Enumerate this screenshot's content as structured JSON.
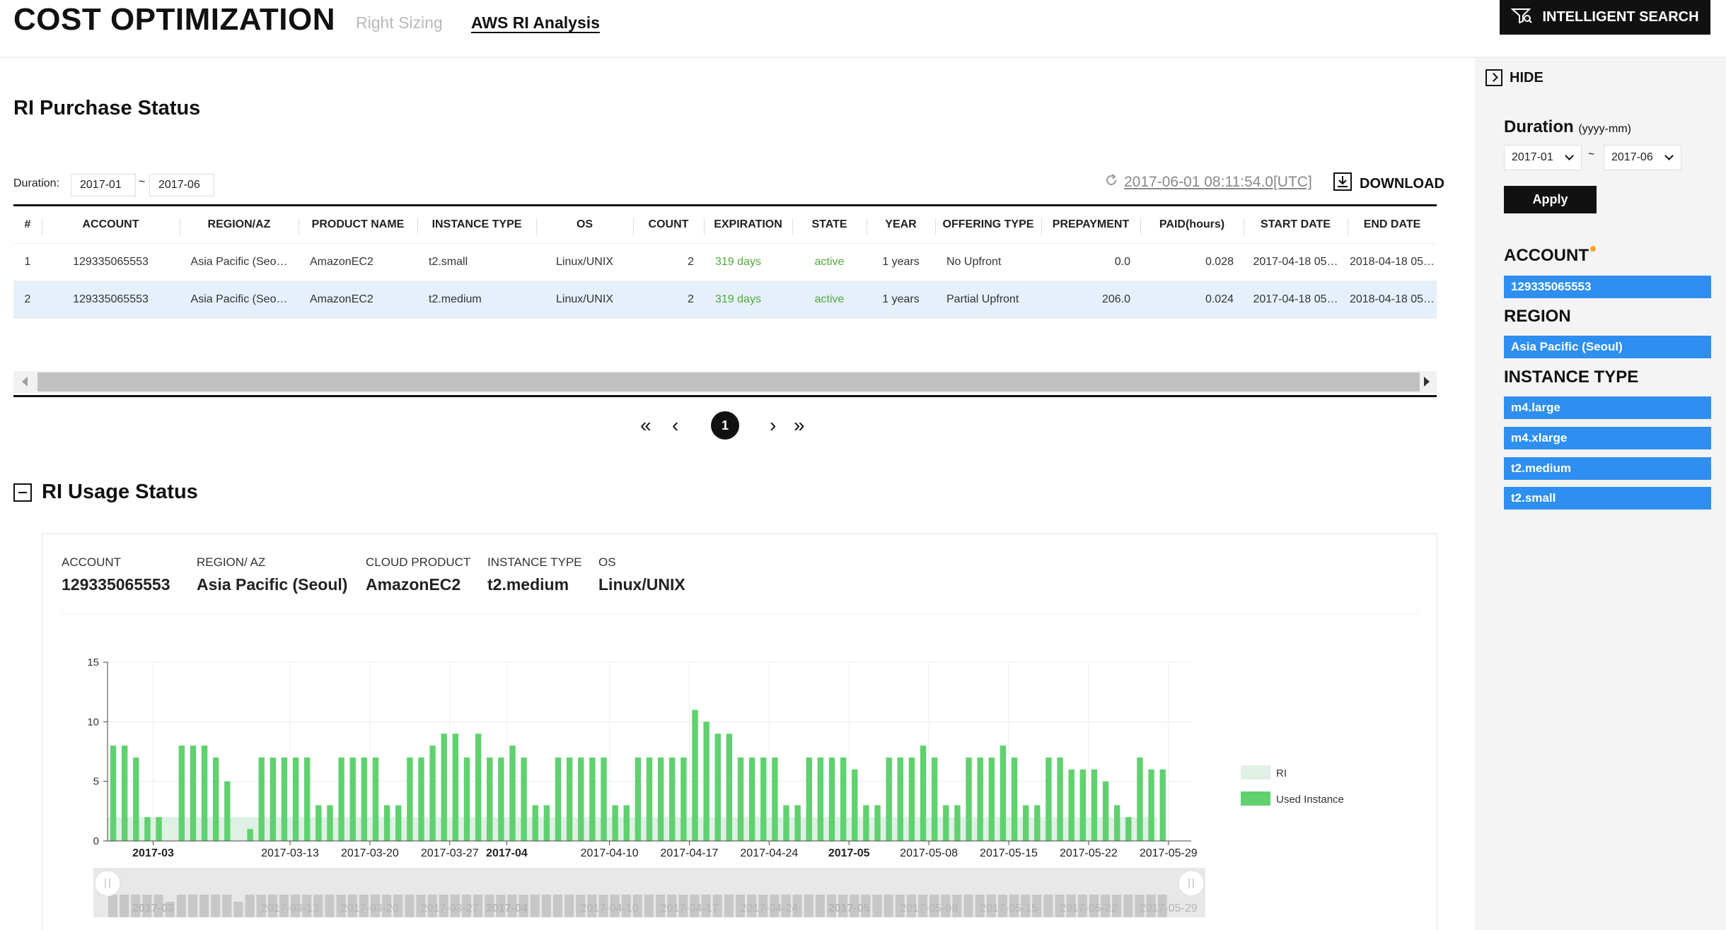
{
  "header": {
    "title": "COST OPTIMIZATION",
    "tabs": [
      {
        "label": "Right Sizing",
        "active": false
      },
      {
        "label": "AWS RI Analysis",
        "active": true
      }
    ],
    "intelligent_search_label": "INTELLIGENT SEARCH"
  },
  "purchase": {
    "title": "RI Purchase Status",
    "duration_label": "Duration:",
    "duration_from": "2017-01",
    "duration_to": "2017-06",
    "tilde": "~",
    "timestamp": "2017-06-01 08:11:54.0[UTC]",
    "download_label": "DOWNLOAD",
    "columns": [
      "#",
      "ACCOUNT",
      "REGION/AZ",
      "PRODUCT NAME",
      "INSTANCE TYPE",
      "OS",
      "COUNT",
      "EXPIRATION",
      "STATE",
      "YEAR",
      "OFFERING TYPE",
      "PREPAYMENT",
      "PAID(hours)",
      "START DATE",
      "END DATE"
    ],
    "rows": [
      {
        "n": "1",
        "account": "129335065553",
        "region": "Asia Pacific (Seo…",
        "product": "AmazonEC2",
        "instance_type": "t2.small",
        "os": "Linux/UNIX",
        "count": "2",
        "expiration": "319 days",
        "state": "active",
        "year": "1 years",
        "offering": "No Upfront",
        "prepayment": "0.0",
        "paid": "0.028",
        "start": "2017-04-18 05…",
        "end": "2018-04-18 05…"
      },
      {
        "n": "2",
        "account": "129335065553",
        "region": "Asia Pacific (Seo…",
        "product": "AmazonEC2",
        "instance_type": "t2.medium",
        "os": "Linux/UNIX",
        "count": "2",
        "expiration": "319 days",
        "state": "active",
        "year": "1 years",
        "offering": "Partial Upfront",
        "prepayment": "206.0",
        "paid": "0.024",
        "start": "2017-04-18 05…",
        "end": "2018-04-18 05…"
      }
    ],
    "pager": {
      "first": "«",
      "prev": "‹",
      "current": "1",
      "next": "›",
      "last": "»"
    }
  },
  "usage": {
    "title": "RI Usage Status",
    "info": [
      {
        "label": "ACCOUNT",
        "value": "129335065553"
      },
      {
        "label": "REGION/ AZ",
        "value": "Asia Pacific (Seoul)"
      },
      {
        "label": "CLOUD PRODUCT",
        "value": "AmazonEC2"
      },
      {
        "label": "INSTANCE TYPE",
        "value": "t2.medium"
      },
      {
        "label": "OS",
        "value": "Linux/UNIX"
      }
    ]
  },
  "sidebar": {
    "hide_label": "HIDE",
    "duration_title": "Duration",
    "duration_hint": "(yyyy-mm)",
    "from": "2017-01",
    "to": "2017-06",
    "tilde": "~",
    "apply_label": "Apply",
    "account_title": "ACCOUNT",
    "account_tags": [
      "129335065553"
    ],
    "region_title": "REGION",
    "region_tags": [
      "Asia Pacific (Seoul)"
    ],
    "instance_title": "INSTANCE TYPE",
    "instance_tags": [
      "m4.large",
      "m4.xlarge",
      "t2.medium",
      "t2.small"
    ]
  },
  "colors": {
    "ri": "#dff0e5",
    "used": "#5fd16e",
    "tag": "#2e8ff0",
    "active_text": "#52a93a"
  },
  "chart_data": {
    "type": "bar",
    "ylim": [
      0,
      15
    ],
    "yticks": [
      0,
      5,
      10,
      15
    ],
    "x_start": "2017-02-25",
    "x_end": "2017-05-31",
    "xtick_labels": [
      {
        "label": "2017-03",
        "major": true,
        "date": "2017-03-01"
      },
      {
        "label": "2017-03-13",
        "major": false,
        "date": "2017-03-13"
      },
      {
        "label": "2017-03-20",
        "major": false,
        "date": "2017-03-20"
      },
      {
        "label": "2017-03-27",
        "major": false,
        "date": "2017-03-27"
      },
      {
        "label": "2017-04",
        "major": true,
        "date": "2017-04-01"
      },
      {
        "label": "2017-04-10",
        "major": false,
        "date": "2017-04-10"
      },
      {
        "label": "2017-04-17",
        "major": false,
        "date": "2017-04-17"
      },
      {
        "label": "2017-04-24",
        "major": false,
        "date": "2017-04-24"
      },
      {
        "label": "2017-05",
        "major": true,
        "date": "2017-05-01"
      },
      {
        "label": "2017-05-08",
        "major": false,
        "date": "2017-05-08"
      },
      {
        "label": "2017-05-15",
        "major": false,
        "date": "2017-05-15"
      },
      {
        "label": "2017-05-22",
        "major": false,
        "date": "2017-05-22"
      },
      {
        "label": "2017-05-29",
        "major": false,
        "date": "2017-05-29"
      }
    ],
    "series": [
      {
        "name": "RI",
        "values": [
          2,
          2,
          2,
          2,
          2,
          2,
          2,
          2,
          2,
          2,
          2,
          2,
          2,
          2,
          2,
          2,
          2,
          2,
          2,
          2,
          2,
          2,
          2,
          2,
          2,
          2,
          2,
          2,
          2,
          2,
          2,
          2,
          2,
          2,
          2,
          2,
          2,
          2,
          2,
          2,
          2,
          2,
          2,
          2,
          2,
          2,
          2,
          2,
          2,
          2,
          2,
          2,
          2,
          2,
          2,
          2,
          2,
          2,
          2,
          2,
          2,
          2,
          2,
          2,
          2,
          2,
          2,
          2,
          2,
          2,
          2,
          2,
          2,
          2,
          2,
          2,
          2,
          2,
          2,
          2,
          2,
          2,
          2,
          2,
          2,
          2,
          2,
          2,
          2,
          2,
          2,
          2
        ]
      },
      {
        "name": "Used Instance",
        "values": [
          8,
          8,
          7,
          2,
          2,
          0,
          8,
          8,
          8,
          7,
          5,
          0,
          1,
          7,
          7,
          7,
          7,
          7,
          3,
          3,
          7,
          7,
          7,
          7,
          3,
          3,
          7,
          7,
          8,
          9,
          9,
          7,
          9,
          7,
          7,
          8,
          7,
          3,
          3,
          7,
          7,
          7,
          7,
          7,
          3,
          3,
          7,
          7,
          7,
          7,
          7,
          11,
          10,
          9,
          9,
          7,
          7,
          7,
          7,
          3,
          3,
          7,
          7,
          7,
          7,
          6,
          3,
          3,
          7,
          7,
          7,
          8,
          7,
          3,
          3,
          7,
          7,
          7,
          8,
          7,
          3,
          3,
          7,
          7,
          6,
          6,
          6,
          5,
          3,
          2,
          7,
          6,
          6
        ]
      }
    ]
  }
}
